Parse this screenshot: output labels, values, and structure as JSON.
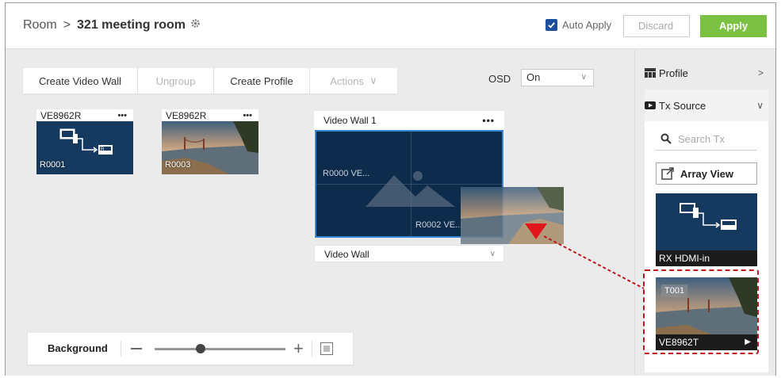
{
  "header": {
    "room_label": "Room",
    "separator": ">",
    "room_name": "321 meeting room",
    "auto_apply_label": "Auto Apply",
    "auto_apply_checked": true,
    "discard_label": "Discard",
    "apply_label": "Apply"
  },
  "toolbar": {
    "create_video_wall": "Create Video Wall",
    "ungroup": "Ungroup",
    "create_profile": "Create Profile",
    "actions": "Actions",
    "actions_chevron": "∨"
  },
  "osd": {
    "label": "OSD",
    "value": "On"
  },
  "receivers": [
    {
      "name": "VE8962R",
      "menu": "•••",
      "label": "R0001",
      "thumb": "hdmi-in-icon"
    },
    {
      "name": "VE8962R",
      "menu": "•••",
      "label": "R0003",
      "thumb": "bridge-photo"
    }
  ],
  "video_wall": {
    "title": "Video Wall 1",
    "menu": "•••",
    "tile_label_1": "R0000 VE...",
    "tile_label_2": "R0002 VE...",
    "mode_value": "Video Wall"
  },
  "background_bar": {
    "label": "Background",
    "zoom_level": 0.35
  },
  "sidebar": {
    "profile_label": "Profile",
    "profile_arrow": ">",
    "tx_source_label": "Tx Source",
    "tx_source_arrow": "∨",
    "search_placeholder": "Search Tx",
    "array_view_label": "Array View",
    "sources": [
      {
        "label": "RX HDMI-in",
        "thumb": "hdmi-in-icon"
      },
      {
        "label": "VE8962T",
        "badge": "T001",
        "thumb": "bridge-photo",
        "play": "▶"
      }
    ]
  },
  "colors": {
    "apply_green": "#7dc142",
    "navy_tile": "#163a5f",
    "selection_blue": "#3a86d6",
    "drag_red": "#c0161b"
  }
}
